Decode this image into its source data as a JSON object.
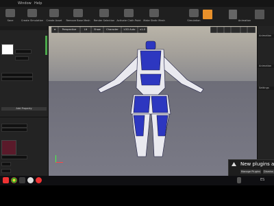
{
  "menu": {
    "items": [
      "Window",
      "Help"
    ]
  },
  "toolbar": {
    "buttons": [
      {
        "label": "Save"
      },
      {
        "label": "Create Simulation"
      },
      {
        "label": "Create Asset"
      },
      {
        "label": "Remove Base Mesh"
      },
      {
        "label": "Render Selection"
      },
      {
        "label": "Activate Cloth Paint"
      },
      {
        "label": "Make Static Mesh"
      }
    ],
    "right_labels": [
      "Simulation",
      "Animation"
    ]
  },
  "viewport": {
    "buttons": [
      "Perspective",
      "Lit",
      "Show",
      "Character",
      "LOD Auto",
      "x1.0"
    ],
    "stats": [
      "",
      "",
      ""
    ]
  },
  "right_panel": {
    "sections": [
      "Animation",
      "Animation",
      "Settings"
    ]
  },
  "left_panel": {
    "button": "Add Property"
  },
  "notification": {
    "title": "New plugins are",
    "manage_button": "Manage Plugins",
    "dismiss_button": "Dismiss"
  },
  "taskbar": {
    "lang": "ES",
    "apps": [
      "chrome-icon",
      "opera-icon",
      "file-explorer-icon",
      "unreal-icon",
      "opera-icon"
    ]
  },
  "colors": {
    "suit_blue": "#2d37c0",
    "suit_white": "#e9e9ef",
    "accent_orange": "#e8902a"
  }
}
